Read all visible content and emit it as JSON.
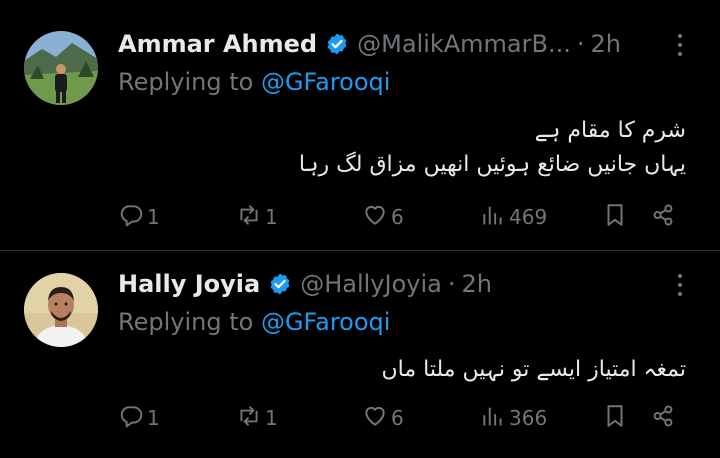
{
  "tweets": [
    {
      "name": "Ammar Ahmed",
      "handle": "@MalikAmmarB...",
      "separator": "·",
      "time": "2h",
      "replying_prefix": "Replying to ",
      "replying_to": "@GFarooqi",
      "lines": [
        "شرم کا مقام ہے",
        "یہاں جانیں ضائع ہوئیں انھیں مزاق لگ رہا"
      ],
      "replies": "1",
      "reposts": "1",
      "likes": "6",
      "views": "469"
    },
    {
      "name": "Hally Joyia",
      "handle": "@HallyJoyia",
      "separator": "·",
      "time": "2h",
      "replying_prefix": "Replying to ",
      "replying_to": "@GFarooqi",
      "lines": [
        "تمغہ امتیاز ایسے تو نہیں ملتا ماں"
      ],
      "replies": "1",
      "reposts": "1",
      "likes": "6",
      "views": "366"
    }
  ],
  "colors": {
    "background": "#000000",
    "text": "#e7e9ea",
    "muted": "#71767b",
    "accent": "#1d9bf0",
    "divider": "#2f3336"
  },
  "icons": [
    "verified-badge-icon",
    "more-icon",
    "reply-icon",
    "repost-icon",
    "like-icon",
    "views-icon",
    "bookmark-icon",
    "share-icon"
  ]
}
